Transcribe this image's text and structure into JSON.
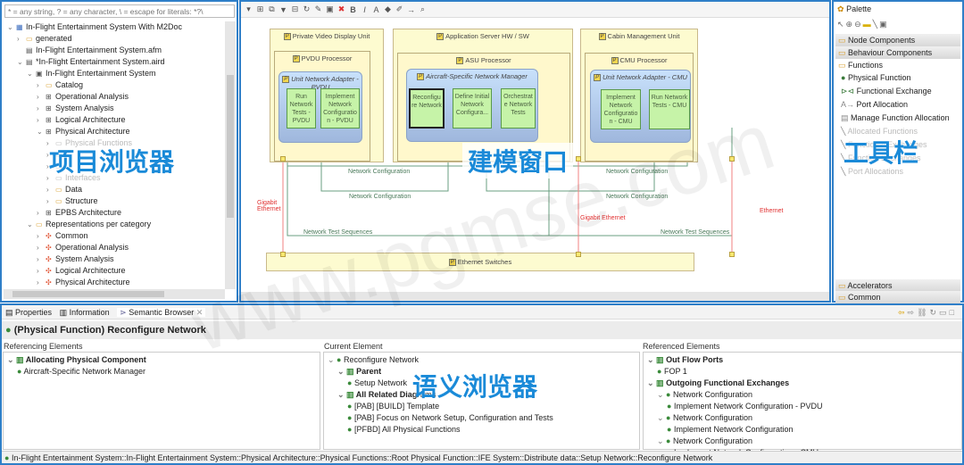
{
  "explorer": {
    "filter_placeholder": "* = any string, ? = any character, \\ = escape for literals: *?\\",
    "items": [
      {
        "level": 0,
        "chev": "v",
        "icon": "project-icon",
        "label": "In-Flight Entertainment System With M2Doc"
      },
      {
        "level": 1,
        "chev": ">",
        "icon": "folder-icon",
        "label": "generated"
      },
      {
        "level": 1,
        "chev": "",
        "icon": "file-icon",
        "label": "In-Flight Entertainment System.afm"
      },
      {
        "level": 1,
        "chev": "v",
        "icon": "file-icon",
        "label": "*In-Flight Entertainment System.aird"
      },
      {
        "level": 2,
        "chev": "v",
        "icon": "model-icon",
        "label": "In-Flight Entertainment System"
      },
      {
        "level": 3,
        "chev": ">",
        "icon": "folder-icon",
        "label": "Catalog"
      },
      {
        "level": 3,
        "chev": ">",
        "icon": "package-icon",
        "label": "Operational Analysis"
      },
      {
        "level": 3,
        "chev": ">",
        "icon": "package-icon",
        "label": "System Analysis"
      },
      {
        "level": 3,
        "chev": ">",
        "icon": "package-icon",
        "label": "Logical Architecture"
      },
      {
        "level": 3,
        "chev": "v",
        "icon": "package-icon",
        "label": "Physical Architecture"
      },
      {
        "level": 4,
        "chev": ">",
        "icon": "folder-icon",
        "label": "Physical Functions",
        "dim": true
      },
      {
        "level": 4,
        "chev": ">",
        "icon": "folder-icon",
        "label": "",
        "dim": true
      },
      {
        "level": 4,
        "chev": ">",
        "icon": "folder-icon",
        "label": "",
        "dim": true
      },
      {
        "level": 4,
        "chev": ">",
        "icon": "folder-icon",
        "label": "Interfaces",
        "dim": true
      },
      {
        "level": 4,
        "chev": ">",
        "icon": "folder-icon",
        "label": "Data"
      },
      {
        "level": 4,
        "chev": ">",
        "icon": "folder-icon",
        "label": "Structure"
      },
      {
        "level": 3,
        "chev": ">",
        "icon": "package-icon",
        "label": "EPBS Architecture"
      },
      {
        "level": 2,
        "chev": "v",
        "icon": "folder-icon",
        "label": "Representations per category"
      },
      {
        "level": 3,
        "chev": ">",
        "icon": "category-icon",
        "label": "Common"
      },
      {
        "level": 3,
        "chev": ">",
        "icon": "category-icon",
        "label": "Operational Analysis"
      },
      {
        "level": 3,
        "chev": ">",
        "icon": "category-icon",
        "label": "System Analysis"
      },
      {
        "level": 3,
        "chev": ">",
        "icon": "category-icon",
        "label": "Logical Architecture"
      },
      {
        "level": 3,
        "chev": ">",
        "icon": "category-icon",
        "label": "Physical Architecture"
      },
      {
        "level": 3,
        "chev": ">",
        "icon": "category-icon",
        "label": "EPBS architecture"
      }
    ]
  },
  "overlays": {
    "explorer": "项目浏览器",
    "editor": "建模窗口",
    "palette": "工具栏",
    "semantic": "语义浏览器",
    "watermark": "www.pgmse.com"
  },
  "diagram": {
    "units": {
      "pvdu": "Private Video Display Unit",
      "app": "Application Server HW / SW",
      "cabin": "Cabin Management Unit",
      "switches": "Ethernet Switches"
    },
    "processors": {
      "pvdu": "PVDU Processor",
      "asu": "ASU Processor",
      "cmu": "CMU Processor"
    },
    "adapters": {
      "pvdu": "Unit Network Adapter - PVDU",
      "asnm": "Aircraft-Specific Network Manager",
      "cmu": "Unit Network Adapter - CMU"
    },
    "functions": {
      "pvdu_run": "Run Network Tests - PVDU",
      "pvdu_impl": "Implement Network Configuratio n - PVDU",
      "reconf": "Reconfigu re Network",
      "define": "Define Initial Network Configura...",
      "orch": "Orchestrat e Network Tests",
      "cmu_impl": "Implement Network Configuratio n - CMU",
      "cmu_run": "Run Network Tests - CMU"
    },
    "links": {
      "nc": "Network Configuration",
      "nts": "Network Test Sequences",
      "ge": "Gigabit Ethernet",
      "ge2": "Gigabit Ethernet",
      "eth": "Ethernet"
    }
  },
  "palette": {
    "title": "Palette",
    "drawers": [
      "Node Components",
      "Behaviour Components",
      "Functions",
      "Accelerators",
      "Common"
    ],
    "tools": [
      {
        "label": "Physical Function"
      },
      {
        "label": "Functional Exchange"
      },
      {
        "label": "Port Allocation"
      },
      {
        "label": "Manage Function Allocation"
      },
      {
        "label": "Allocated Functions",
        "dim": true
      },
      {
        "label": "Functional Exchanges",
        "dim": true
      },
      {
        "label": "Function Exchanges",
        "dim": true
      },
      {
        "label": "Port Allocations",
        "dim": true
      }
    ]
  },
  "bottom": {
    "tabs": [
      "Properties",
      "Information",
      "Semantic Browser"
    ],
    "title": "(Physical Function) Reconfigure Network",
    "col_headers": [
      "Referencing Elements",
      "Current Element",
      "Referenced Elements"
    ],
    "referencing": [
      {
        "level": 0,
        "label": "Allocating Physical Component",
        "bold": true
      },
      {
        "level": 1,
        "label": "Aircraft-Specific Network Manager"
      }
    ],
    "current": [
      {
        "level": 0,
        "label": "Reconfigure Network"
      },
      {
        "level": 1,
        "label": "Parent",
        "bold": true
      },
      {
        "level": 2,
        "label": "Setup Network"
      },
      {
        "level": 1,
        "label": "All Related Diagrams",
        "bold": true
      },
      {
        "level": 2,
        "label": "[PAB] [BUILD] Template"
      },
      {
        "level": 2,
        "label": "[PAB] Focus on Network Setup, Configuration and Tests"
      },
      {
        "level": 2,
        "label": "[PFBD] All Physical Functions"
      }
    ],
    "referenced": [
      {
        "level": 0,
        "label": "Out Flow Ports",
        "bold": true
      },
      {
        "level": 1,
        "label": "FOP 1"
      },
      {
        "level": 0,
        "label": "Outgoing Functional Exchanges",
        "bold": true
      },
      {
        "level": 1,
        "label": "Network Configuration"
      },
      {
        "level": 2,
        "label": "Implement Network Configuration - PVDU"
      },
      {
        "level": 1,
        "label": "Network Configuration"
      },
      {
        "level": 2,
        "label": "Implement Network Configuration"
      },
      {
        "level": 1,
        "label": "Network Configuration"
      },
      {
        "level": 2,
        "label": "Implement Network Configuration - CMU"
      }
    ],
    "status": "In-Flight Entertainment System::In-Flight Entertainment System::Physical Architecture::Physical Functions::Root Physical Function::IFE System::Distribute data::Setup Network::Reconfigure Network"
  },
  "colors": {
    "accent": "#2f7fc8",
    "function": "#c6f3a8",
    "component": "#fdfbd0",
    "exchange": "#4a7a5a",
    "physical_link": "#e03030"
  }
}
